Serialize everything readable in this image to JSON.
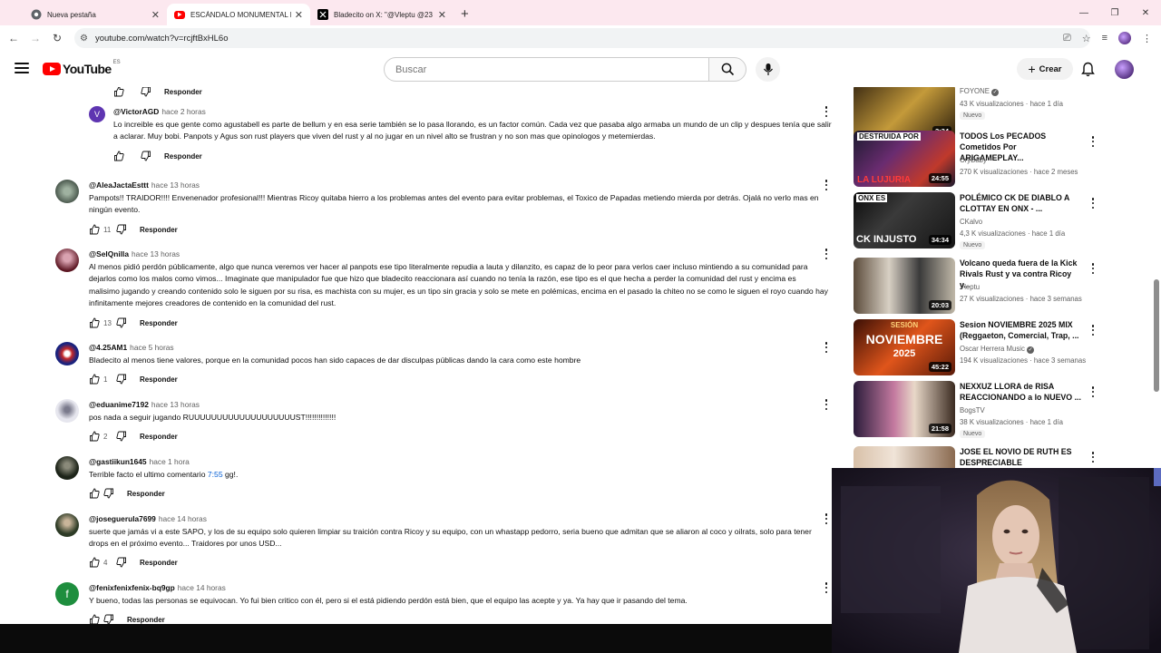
{
  "browser": {
    "tabs": [
      {
        "title": "Nueva pestaña",
        "active": false,
        "favicon": "chrome-icon"
      },
      {
        "title": "ESCÁNDALO MONUMENTAL BL",
        "active": true,
        "favicon": "youtube-icon"
      },
      {
        "title": "Bladecito on X: \"@Vleptu @23",
        "active": false,
        "favicon": "x-icon"
      }
    ],
    "url": "youtube.com/watch?v=rcjftBxHL6o"
  },
  "youtube": {
    "logo_text": "YouTube",
    "region": "ES",
    "search_placeholder": "Buscar",
    "create_label": "Crear"
  },
  "comments": [
    {
      "reply_label": "Responder"
    },
    {
      "handle": "@VictorAGD",
      "time": "hace 2 horas",
      "avatar_letter": "V",
      "text": "Lo increible es que gente como agustabell es parte de bellum y en esa serie también se lo pasa llorando, es un factor común. Cada vez que pasaba algo armaba un mundo de un clip y despues tenía que salir a aclarar. Muy bobi.  Panpots y Agus son rust players que viven del rust y al no jugar en un nivel alto se frustran y no son mas que opinologos y metemierdas.",
      "likes": "",
      "reply_label": "Responder"
    },
    {
      "handle": "@AleaJactaEsttt",
      "time": "hace 13 horas",
      "text": "Pampots!! TRAIDOR!!!! Envenenador profesional!!! Mientras Ricoy quitaba hierro a los problemas antes del evento para evitar problemas, el Toxico de Papadas metiendo mierda por detrás. Ojalá no verlo mas en ningún evento.",
      "likes": "11",
      "reply_label": "Responder"
    },
    {
      "handle": "@SelQnilla",
      "time": "hace 13 horas",
      "text": "Al menos pidió perdón públicamente, algo que nunca veremos ver hacer al panpots ese tipo literalmente repudia a lauta y dilanzito, es capaz de lo peor para verlos caer incluso mintiendo a su comunidad para dejarlos como los malos como vimos... Imaginate que manipulador fue que hizo que bladecito reaccionara así cuando no tenía la razón, ese tipo es el que hecha a perder la comunidad del rust y encima es malisimo jugando y creando contenido solo le siguen por su risa, es machista con su mujer, es un tipo sin gracia y solo se mete en polémicas, encima en el pasado la chiteo no se como le siguen el royo cuando hay infinitamente mejores creadores de contenido en la comunidad del rust.",
      "likes": "13",
      "reply_label": "Responder"
    },
    {
      "handle": "@4.25AM1",
      "time": "hace 5 horas",
      "text": "Bladecito al menos tiene valores, porque en la comunidad pocos han sido capaces de dar disculpas públicas dando la cara como este hombre",
      "likes": "1",
      "reply_label": "Responder"
    },
    {
      "handle": "@eduanime7192",
      "time": "hace 13 horas",
      "text": "pos nada a seguir jugando RUUUUUUUUUUUUUUUUUUUST!!!!!!!!!!!!!!",
      "likes": "2",
      "reply_label": "Responder"
    },
    {
      "handle": "@gastiikun1645",
      "time": "hace 1 hora",
      "text_before": "Terrible facto el ultimo comentario ",
      "timestamp": "7:55",
      "text_after": "  gg!.",
      "likes": "",
      "reply_label": "Responder"
    },
    {
      "handle": "@joseguerula7699",
      "time": "hace 14 horas",
      "text": "suerte que jamás vi a este SAPO, y los de su equipo solo quieren limpiar su traición contra Ricoy y su equipo, con un whastapp pedorro, seria bueno que admitan que se aliaron al coco y oilrats, solo para tener drops en el próximo evento... Traidores por unos USD...",
      "likes": "4",
      "reply_label": "Responder"
    },
    {
      "handle": "@fenixfenixfenix-bq9gp",
      "time": "hace 14 horas",
      "avatar_letter": "f",
      "text": "Y bueno, todas las personas se equivocan. Yo fui bien critico con él, pero si el está pidiendo perdón está bien, que el equipo las acepte y ya. Ya hay que ir pasando del tema.",
      "likes": "",
      "reply_label": "Responder"
    }
  ],
  "videos": [
    {
      "title": "",
      "channel": "FOYONE",
      "verified": true,
      "meta": "43 K visualizaciones · hace 1 día",
      "badge": "Nuevo",
      "duration": "2:24"
    },
    {
      "title": "TODOS Los PECADOS Cometidos Por ARIGAMEPLAY...",
      "channel": "CryBaby",
      "verified": false,
      "meta": "270 K visualizaciones · hace 2 meses",
      "badge": "",
      "duration": "24:55",
      "thumb_text": "DESTRUIDA POR",
      "thumb_text2": "LA LUJURIA"
    },
    {
      "title": "POLÉMICO CK DE DIABLO A CLOTTAY EN ONX - ...",
      "channel": "CKalvo",
      "verified": false,
      "meta": "4,3 K visualizaciones · hace 1 día",
      "badge": "Nuevo",
      "duration": "34:34",
      "thumb_text": "ONX ES",
      "thumb_text2": "CK INJUSTO"
    },
    {
      "title": "Volcano queda fuera de la Kick Rivals Rust y va contra Ricoy y...",
      "channel": "Vleptu",
      "verified": false,
      "meta": "27 K visualizaciones · hace 3 semanas",
      "badge": "",
      "duration": "20:03"
    },
    {
      "title": "Sesion NOVIEMBRE 2025 MIX (Reggaeton, Comercial, Trap, ...",
      "channel": "Oscar Herrera Music",
      "verified": true,
      "meta": "194 K visualizaciones · hace 3 semanas",
      "badge": "",
      "duration": "45:22",
      "thumb_text": "SESIÓN",
      "thumb_text2": "NOVIEMBRE",
      "thumb_text3": "2025"
    },
    {
      "title": "NEXXUZ LLORA de RISA REACCIONANDO a lo NUEVO ...",
      "channel": "BogsTV",
      "verified": false,
      "meta": "38 K visualizaciones · hace 1 día",
      "badge": "Nuevo",
      "duration": "21:58"
    },
    {
      "title": "JOSE EL NOVIO DE RUTH ES DESPRECIABLE",
      "channel": "",
      "verified": false,
      "meta": "",
      "badge": "",
      "duration": ""
    }
  ],
  "colors": {
    "youtube_red": "#ff0000",
    "link_blue": "#065fd4",
    "tabbar_bg": "#fce8ef"
  }
}
